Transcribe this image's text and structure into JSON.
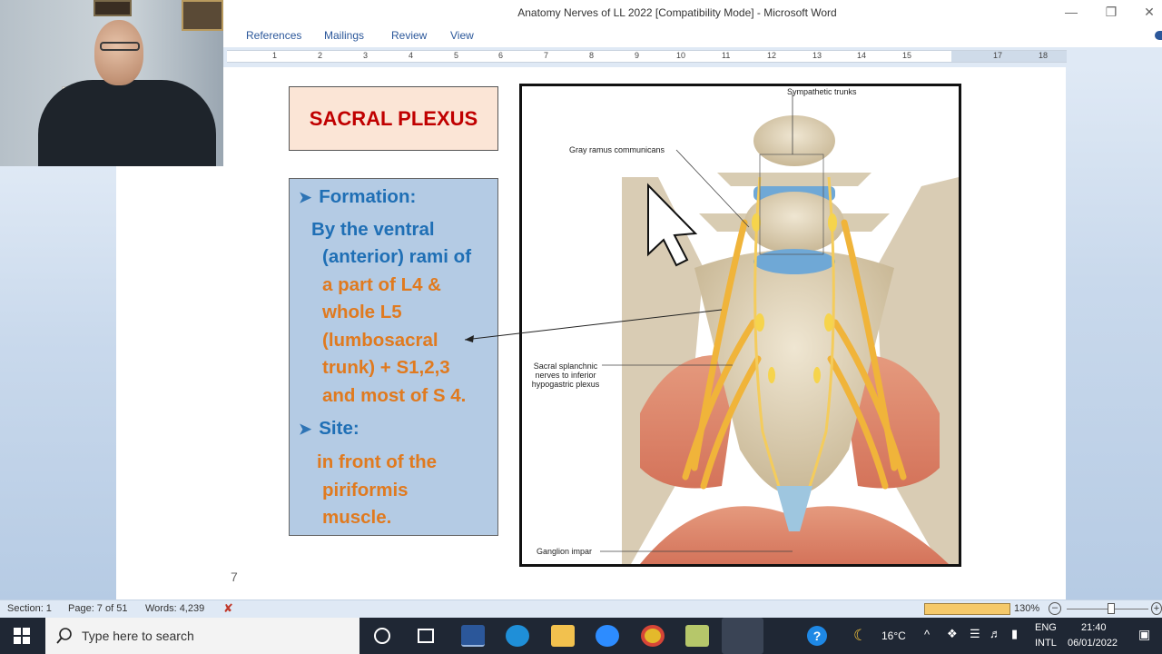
{
  "window": {
    "title": "Anatomy Nerves of LL 2022 [Compatibility Mode] - Microsoft Word"
  },
  "ribbon_tabs": [
    "References",
    "Mailings",
    "Review",
    "View"
  ],
  "ruler_numbers": [
    "1",
    "2",
    "3",
    "4",
    "5",
    "6",
    "7",
    "8",
    "9",
    "10",
    "11",
    "12",
    "13",
    "14",
    "15",
    "17",
    "18"
  ],
  "slide": {
    "title": "SACRAL PLEXUS",
    "formation_label": "Formation:",
    "formation_line1": "By the ventral",
    "formation_line2": "(anterior) rami of",
    "formation_line3": "a part of L4 &",
    "formation_line4": "whole L5",
    "formation_line5": "(lumbosacral",
    "formation_line6": "trunk) + S1,2,3",
    "formation_line7": "and most of S 4.",
    "site_label": "Site:",
    "site_line1": "in front of the",
    "site_line2": "piriformis",
    "site_line3": "muscle.",
    "page_number": "7"
  },
  "figure": {
    "label_sympathetic": "Sympathetic trunks",
    "label_gray_ramus": "Gray ramus communicans",
    "label_sacral_splanchnic_1": "Sacral splanchnic",
    "label_sacral_splanchnic_2": "nerves to inferior",
    "label_sacral_splanchnic_3": "hypogastric plexus",
    "label_ganglion": "Ganglion impar"
  },
  "status": {
    "section": "Section: 1",
    "page": "Page: 7 of 51",
    "words": "Words: 4,239",
    "zoom": "130%"
  },
  "taskbar": {
    "search_placeholder": "Type here to search",
    "weather": "16°C",
    "lang1": "ENG",
    "lang2": "INTL",
    "time": "21:40",
    "date": "06/01/2022"
  }
}
